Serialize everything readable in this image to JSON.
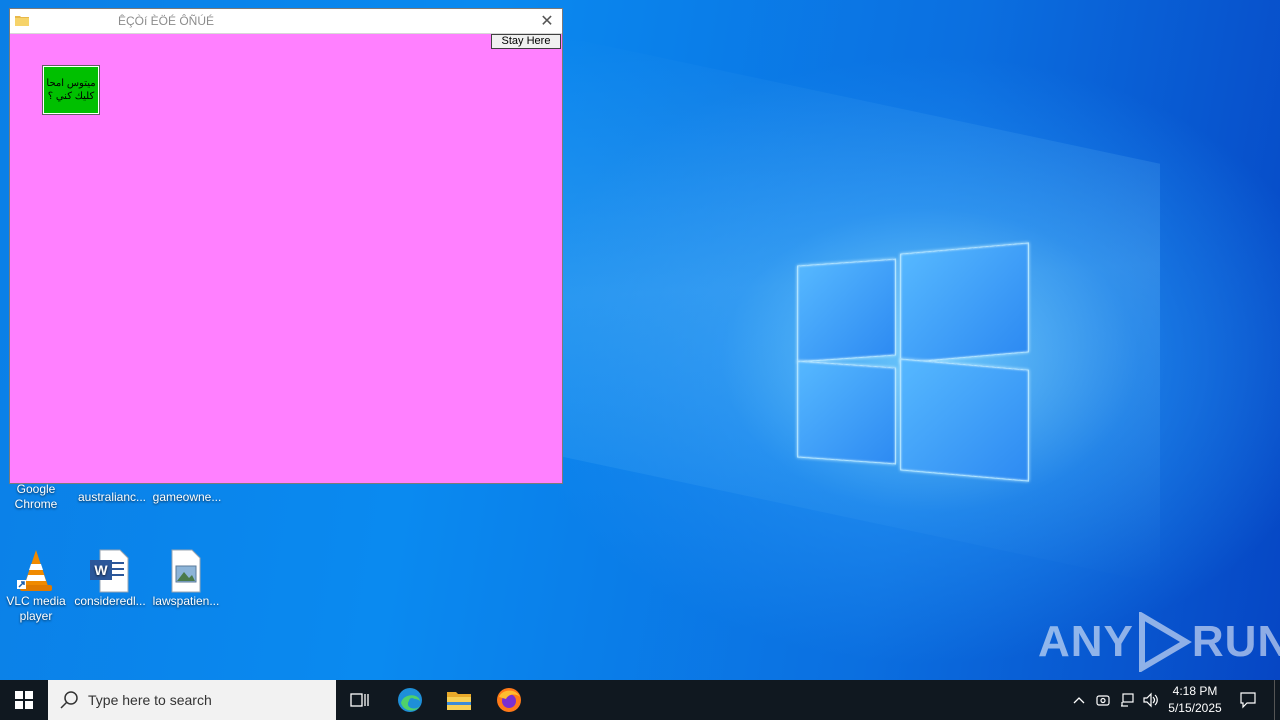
{
  "desktop": {
    "icons": [
      {
        "label": "Google Chrome",
        "icon": "chrome-icon"
      },
      {
        "label": "australianc...",
        "icon": "blank-file-icon"
      },
      {
        "label": "gameowne...",
        "icon": "blank-file-icon"
      },
      {
        "label": "VLC media player",
        "icon": "vlc-icon"
      },
      {
        "label": "consideredl...",
        "icon": "word-document-icon"
      },
      {
        "label": "lawspatien...",
        "icon": "image-file-icon"
      }
    ],
    "watermark": "ANY RUN"
  },
  "app_window": {
    "title": "ÊÇÒí ÈÖÉ ÔÑÚÉ",
    "stay_button": "Stay Here",
    "green_button": "ميتوس امحا كليك كني ؟",
    "background_color": "#ff80ff",
    "button_color": "#00c000"
  },
  "taskbar": {
    "search_placeholder": "Type here to search",
    "apps": [
      "task-view-icon",
      "edge-icon",
      "file-explorer-icon",
      "firefox-icon"
    ],
    "clock_time": "4:18 PM",
    "clock_date": "5/15/2025"
  }
}
